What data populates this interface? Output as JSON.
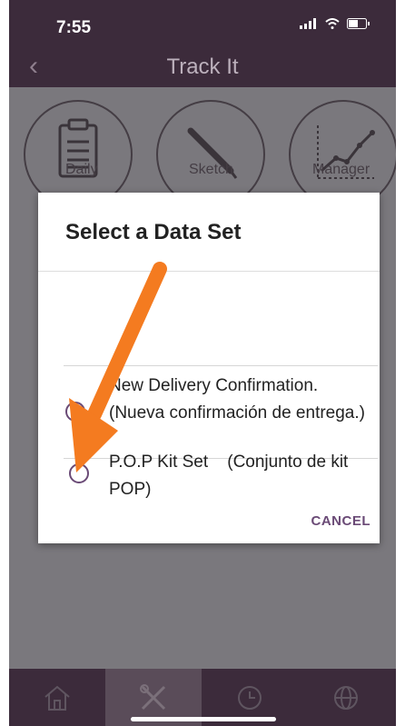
{
  "status": {
    "time": "7:55"
  },
  "app": {
    "title": "Track It",
    "back_icon": "chevron-left-icon"
  },
  "tiles": [
    {
      "icon": "clipboard-icon",
      "label": "Daily"
    },
    {
      "icon": "pencil-icon",
      "label": "Sketch"
    },
    {
      "icon": "line-chart-icon",
      "label": "Manager"
    }
  ],
  "dialog": {
    "title": "Select a Data Set",
    "options": [
      {
        "label": "New Delivery Confirmation. (Nueva confirmación de entrega.)",
        "selected": false
      },
      {
        "label": "P.O.P Kit Set    (Conjunto de kit POP)",
        "selected": false
      }
    ],
    "cancel_label": "CANCEL"
  },
  "bottom_nav": [
    {
      "icon": "home-icon",
      "selected": false
    },
    {
      "icon": "tools-icon",
      "selected": true
    },
    {
      "icon": "clock-icon",
      "selected": false
    },
    {
      "icon": "globe-icon",
      "selected": false
    }
  ],
  "annotation": {
    "arrow_color": "#f47b20"
  }
}
